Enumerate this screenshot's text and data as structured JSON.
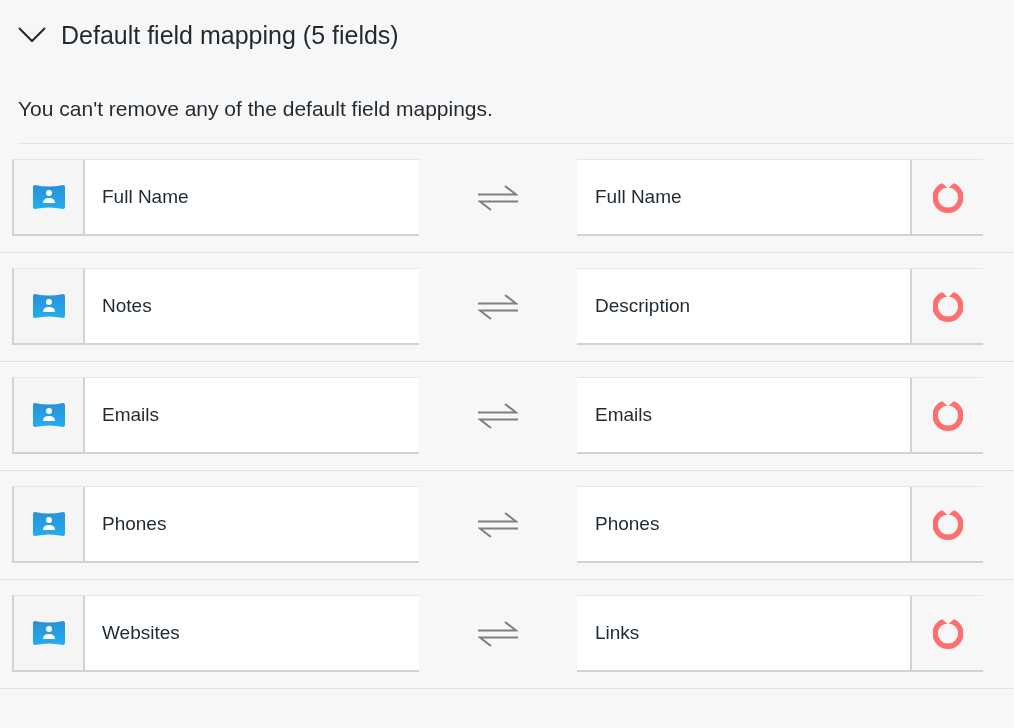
{
  "section": {
    "title": "Default field mapping (5 fields)",
    "expanded": true,
    "note": "You can't remove any of the default field mappings."
  },
  "mappings": [
    {
      "source": "Full Name",
      "target": "Full Name"
    },
    {
      "source": "Notes",
      "target": "Description"
    },
    {
      "source": "Emails",
      "target": "Emails"
    },
    {
      "source": "Phones",
      "target": "Phones"
    },
    {
      "source": "Websites",
      "target": "Links"
    }
  ]
}
